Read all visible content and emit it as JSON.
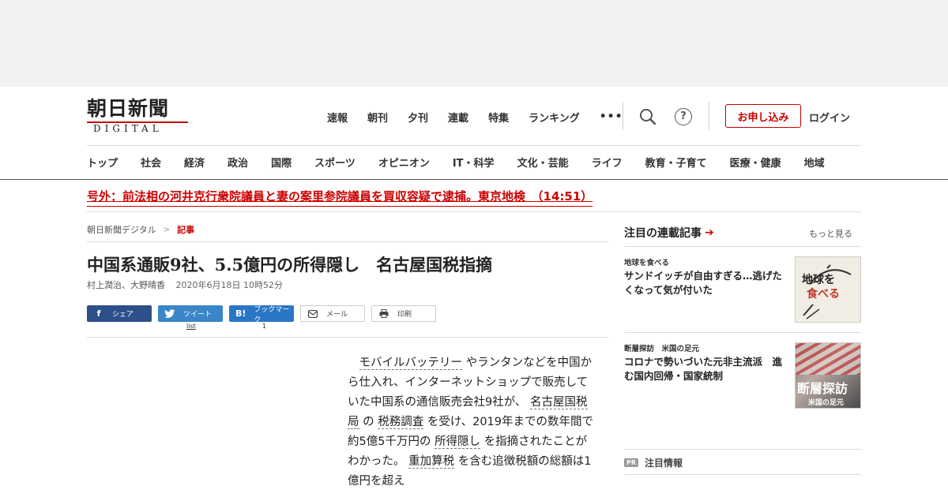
{
  "logo": {
    "main": "朝日新聞",
    "sub": "DIGITAL"
  },
  "top_nav": [
    "速報",
    "朝刊",
    "夕刊",
    "連載",
    "特集",
    "ランキング"
  ],
  "top_nav_more": "•••",
  "header_actions": {
    "help_symbol": "?",
    "apply_label": "お申し込み",
    "login_label": "ログイン"
  },
  "categories": [
    "トップ",
    "社会",
    "経済",
    "政治",
    "国際",
    "スポーツ",
    "オピニオン",
    "IT・科学",
    "文化・芸能",
    "ライフ",
    "教育・子育て",
    "医療・健康",
    "地域"
  ],
  "breaking_news": "号外：前法相の河井克行衆院議員と妻の案里参院議員を買収容疑で逮捕。東京地検　（14:51）",
  "breadcrumb": {
    "home": "朝日新聞デジタル",
    "sep": ">",
    "current": "記事"
  },
  "article": {
    "headline": "中国系通販9社、5.5億円の所得隠し　名古屋国税指摘",
    "authors": "村上潤治、大野晴香",
    "date": "2020年6月18日 10時52分",
    "body": {
      "kw1": "モバイルバッテリー",
      "t1": " やランタンなどを中国から仕入れ、インターネットショップで販売していた中国系の通信販売会社9社が、 ",
      "kw2": "名古屋国税局",
      "t2": " の ",
      "kw3": "税務調査",
      "t3": " を受け、2019年までの数年間で約5億5千万円の ",
      "kw4": "所得隠し",
      "t4": " を指摘されたことがわかった。 ",
      "kw5": "重加算税",
      "t5": " を含む追徴税額の総額は1億円を超え"
    }
  },
  "share": {
    "facebook": "シェア",
    "twitter": "ツイート",
    "hatena": "ブックマーク",
    "mail": "メール",
    "print": "印刷",
    "twitter_count": "list",
    "hatena_count": "1",
    "hatena_icon": "B!",
    "facebook_icon": "f"
  },
  "sidebar": {
    "title": "注目の連載記事",
    "arrow": "➔",
    "more": "もっと見る",
    "cards": [
      {
        "series": "地球を食べる",
        "title": "サンドイッチが自由すぎる…逃げたくなって気が付いた",
        "thumb_text_1": "地球を",
        "thumb_text_2": "食べる"
      },
      {
        "series": "断層探訪　米国の足元",
        "title": "コロナで勢いづいた元非主流派　進む国内回帰・国家統制",
        "thumb_text_1": "断層探訪",
        "thumb_text_2": "米国の足元"
      }
    ],
    "pr_badge": "PR",
    "pr_title": "注目情報"
  },
  "colors": {
    "accent": "#cc0000",
    "facebook": "#2d4f8a",
    "twitter": "#3a86c8",
    "hatena": "#2a76c6"
  }
}
